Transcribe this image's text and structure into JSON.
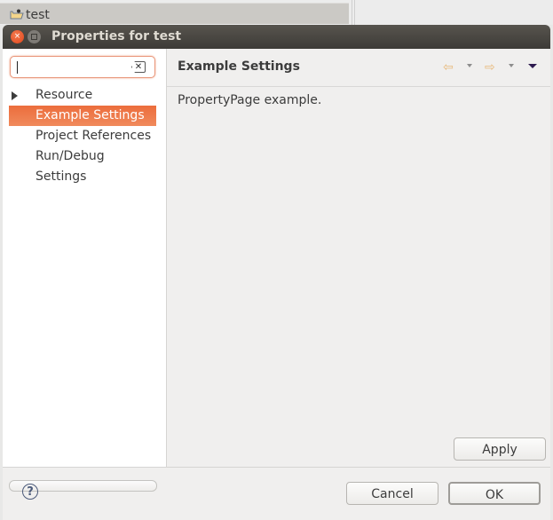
{
  "background": {
    "tree_item_label": "test"
  },
  "dialog": {
    "title": "Properties for test",
    "close_glyph": "×",
    "filter": {
      "value": "",
      "placeholder": "",
      "clear_glyph": "✕"
    },
    "tree": [
      {
        "label": "Resource",
        "expandable": true,
        "selected": false
      },
      {
        "label": "Example Settings",
        "expandable": false,
        "selected": true
      },
      {
        "label": "Project References",
        "expandable": false,
        "selected": false
      },
      {
        "label": "Run/Debug Settings",
        "expandable": false,
        "selected": false
      }
    ],
    "page": {
      "title": "Example Settings",
      "description": "PropertyPage example.",
      "back_glyph": "⇦",
      "forward_glyph": "⇨"
    },
    "buttons": {
      "apply": "Apply",
      "cancel": "Cancel",
      "ok": "OK",
      "help_glyph": "?"
    },
    "colors": {
      "selection": "#ec6d3c",
      "titlebar": "#4a4843"
    }
  }
}
